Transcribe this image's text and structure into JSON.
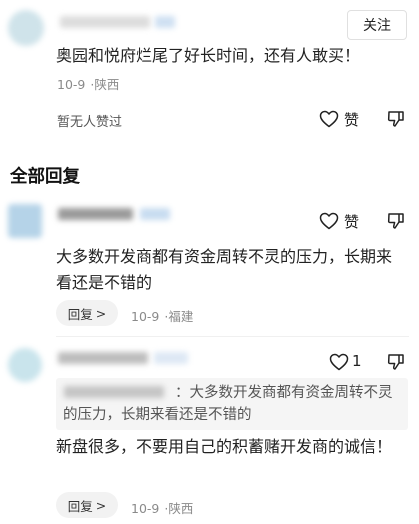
{
  "comment": {
    "follow_label": "关注",
    "text": "奥园和悦府烂尾了好长时间，还有人敢买！",
    "date": "10-9",
    "region": "陕西",
    "no_likes": "暂无人赞过",
    "like_label": "赞"
  },
  "section_title": "全部回复",
  "replies": [
    {
      "text": "大多数开发商都有资金周转不灵的压力，长期来看还是不错的",
      "like_label": "赞",
      "reply_label": "回复",
      "reply_arrow": ">",
      "date": "10-9",
      "region": "福建"
    },
    {
      "like_count": "1",
      "quote": "：大多数开发商都有资金周转不灵的压力，长期来看还是不错的",
      "text": "新盘很多，不要用自己的积蓄赌开发商的诚信！",
      "reply_label": "回复",
      "reply_arrow": ">",
      "date": "10-9",
      "region": "陕西"
    }
  ]
}
